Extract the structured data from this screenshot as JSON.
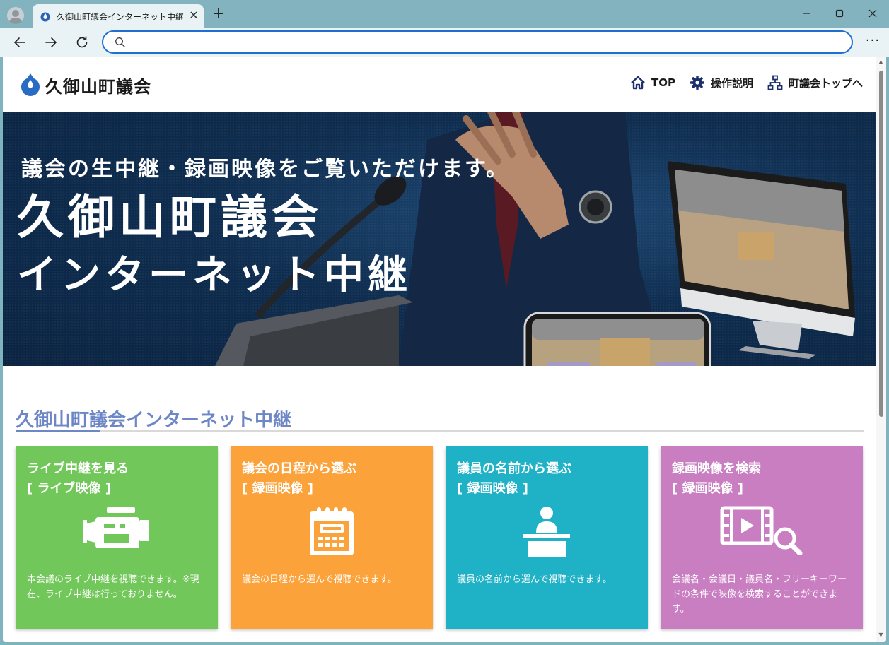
{
  "browser": {
    "tab_title": "久御山町議会インターネット中継",
    "tab_close": "✕",
    "new_tab": "+",
    "address_value": "",
    "menu": "···"
  },
  "site": {
    "logo_text": "久御山町議会",
    "nav": [
      {
        "label": "TOP",
        "icon": "home-icon"
      },
      {
        "label": "操作説明",
        "icon": "gear-icon"
      },
      {
        "label": "町議会トップへ",
        "icon": "sitemap-icon"
      }
    ]
  },
  "hero": {
    "lead": "議会の生中継・録画映像をご覧いただけます。",
    "title_line1": "久御山町議会",
    "title_line2": "インターネット中継"
  },
  "section": {
    "title": "久御山町議会インターネット中継"
  },
  "cards": [
    {
      "title": "ライブ中継を見る",
      "subtitle": "[ ライブ映像 ]",
      "desc": "本会議のライブ中継を視聴できます。※現在、ライブ中継は行っておりません。",
      "color": "#72c75a",
      "icon": "video-camera-icon"
    },
    {
      "title": "議会の日程から選ぶ",
      "subtitle": "[ 録画映像 ]",
      "desc": "議会の日程から選んで視聴できます。",
      "color": "#fba23a",
      "icon": "calendar-icon"
    },
    {
      "title": "議員の名前から選ぶ",
      "subtitle": "[ 録画映像 ]",
      "desc": "議員の名前から選んで視聴できます。",
      "color": "#1fb1c6",
      "icon": "speaker-podium-icon"
    },
    {
      "title": "録画映像を検索",
      "subtitle": "[ 録画映像 ]",
      "desc": "会議名・会議日・議員名・フリーキーワードの条件で映像を検索することができます。",
      "color": "#c97ec1",
      "icon": "video-search-icon"
    }
  ],
  "colors": {
    "accent": "#6d87c6",
    "address_border": "#1f6fd1"
  }
}
